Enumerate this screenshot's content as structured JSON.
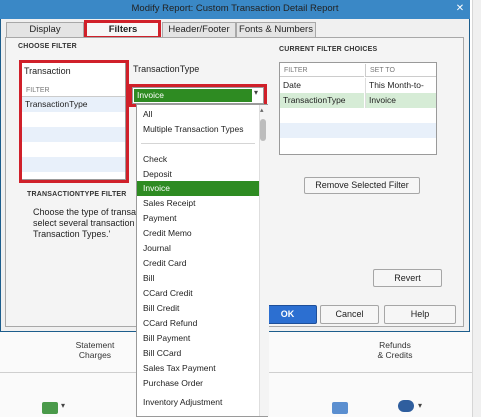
{
  "background": {
    "statement_charges": "Statement\nCharges",
    "refunds_credits": "Refunds\n& Credits"
  },
  "dialog": {
    "title": "Modify Report: Custom Transaction Detail Report",
    "tabs": [
      {
        "label": "Display"
      },
      {
        "label": "Filters"
      },
      {
        "label": "Header/Footer"
      },
      {
        "label": "Fonts & Numbers"
      }
    ],
    "choose_filter": {
      "heading": "CHOOSE FILTER",
      "current_value": "Transaction",
      "list_header": "FILTER",
      "items": [
        "TransactionType",
        "",
        "",
        "",
        "",
        ""
      ],
      "selected_filter_title": "TransactionType"
    },
    "tt_filter": {
      "heading": "TRANSACTIONTYPE FILTER",
      "text_lines": [
        "Choose the type of transacti",
        "select several transaction ty",
        "Transaction Types.'"
      ]
    },
    "combo": {
      "value": "Invoice"
    },
    "dropdown_options": [
      "All",
      "Multiple Transaction Types",
      "Check",
      "Deposit",
      "Invoice",
      "Sales Receipt",
      "Payment",
      "Credit Memo",
      "Journal",
      "Credit Card",
      "Bill",
      "CCard Credit",
      "Bill Credit",
      "CCard Refund",
      "Bill Payment",
      "Bill CCard",
      "Sales Tax Payment",
      "Purchase Order",
      "Inventory Adjustment"
    ],
    "dropdown_selected": "Invoice",
    "current_filters": {
      "heading": "CURRENT FILTER CHOICES",
      "columns": [
        "FILTER",
        "SET TO"
      ],
      "rows": [
        {
          "filter": "Date",
          "set_to": "This Month-to-date"
        },
        {
          "filter": "TransactionType",
          "set_to": "Invoice"
        }
      ]
    },
    "buttons": {
      "remove": "Remove Selected Filter",
      "revert": "Revert",
      "ok": "OK",
      "cancel": "Cancel",
      "help": "Help"
    },
    "colors": {
      "titlebar": "#3a88c6",
      "highlight": "#d0202a",
      "selected": "#2e8b22"
    }
  }
}
